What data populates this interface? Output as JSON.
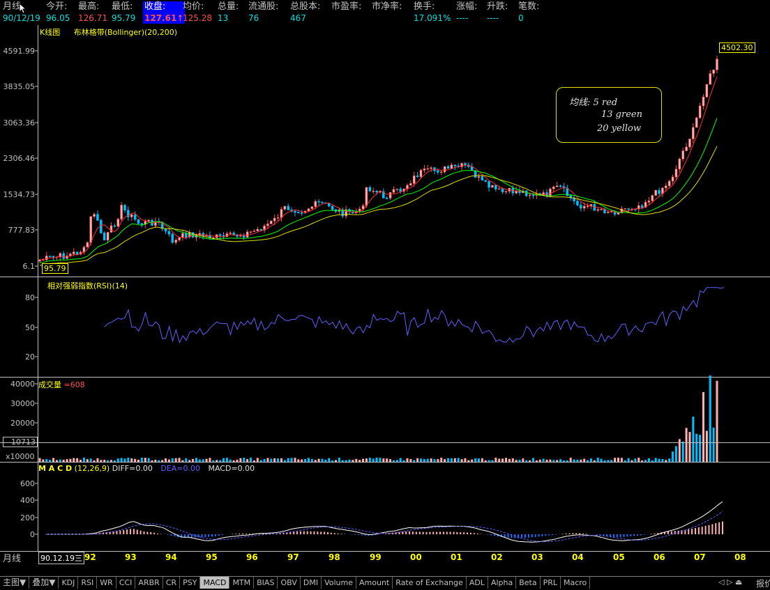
{
  "header": {
    "period_label": "月线",
    "date": "90/12/19",
    "fields": [
      {
        "label": "今开:",
        "value": "96.05",
        "color": "#00e0e0"
      },
      {
        "label": "最高:",
        "value": "126.71",
        "color": "#ff5050"
      },
      {
        "label": "最低:",
        "value": "95.79",
        "color": "#00e0e0"
      },
      {
        "label": "收盘:",
        "value": "127.61↑",
        "color": "#ff5050",
        "highlight": true
      },
      {
        "label": "均价:",
        "value": "125.28",
        "color": "#ff5050"
      },
      {
        "label": "总量:",
        "value": "13",
        "color": "#00e0e0"
      },
      {
        "label": "流通股:",
        "value": "76",
        "color": "#00e0e0"
      },
      {
        "label": "总股本:",
        "value": "467",
        "color": "#00e0e0"
      },
      {
        "label": "市盈率:",
        "value": "",
        "color": "#00e0e0"
      },
      {
        "label": "市净率:",
        "value": "",
        "color": "#00e0e0"
      },
      {
        "label": "换手:",
        "value": "17.091%",
        "color": "#00e0e0"
      },
      {
        "label": "涨幅:",
        "value": "----",
        "color": "#00e0e0"
      },
      {
        "label": "升跌:",
        "value": "----",
        "color": "#00e0e0"
      },
      {
        "label": "笔数:",
        "value": "0",
        "color": "#00e0e0"
      }
    ]
  },
  "kline_panel": {
    "title_k": "K线图",
    "title_indicator": "布林格带(Bollinger)(20,200)",
    "y_ticks": [
      "4591.99",
      "3835.05",
      "3063.36",
      "2306.46",
      "1534.73",
      "777.83",
      "6.1"
    ],
    "last_price_tag": "4502.30",
    "low_tag": "95.79",
    "note_lines": [
      "均线:  5 red",
      "13 green",
      "20  yellow"
    ]
  },
  "rsi_panel": {
    "title": "相对强弱指数(RSI)(14)",
    "y_ticks": [
      "80",
      "50",
      "20"
    ]
  },
  "volume_panel": {
    "title": "成交量",
    "value": "=608",
    "y_ticks": [
      "40000",
      "30000",
      "20000"
    ],
    "cursor_value": "10713",
    "unit": "x10000"
  },
  "macd_panel": {
    "title": "M A C D",
    "params": "(12,26,9)",
    "diff": "DIFF=0.00",
    "dea": "DEA=0.00",
    "macd": "MACD=0.00",
    "y_ticks": [
      "600",
      "400",
      "200",
      "0"
    ]
  },
  "x_axis": {
    "period_label": "月线",
    "cursor_date": "90.12.19三",
    "years": [
      "92",
      "93",
      "94",
      "95",
      "96",
      "97",
      "98",
      "99",
      "00",
      "01",
      "02",
      "03",
      "04",
      "05",
      "06",
      "07",
      "08"
    ]
  },
  "bottom_tabs": {
    "main": "主图▼",
    "overlay": "叠加▼",
    "tabs": [
      "KDJ",
      "RSI",
      "WR",
      "CCI",
      "ARBR",
      "CR",
      "PSY",
      "MACD",
      "MTM",
      "BIAS",
      "OBV",
      "DMI",
      "Volume",
      "Amount",
      "Rate of Exchange",
      "ADL",
      "Alpha",
      "Beta",
      "PRL",
      "Macro"
    ],
    "active": "MACD",
    "right_label": "报价"
  },
  "colors": {
    "up": "#ff5050",
    "down": "#00c0ff",
    "ma5": "#ff3030",
    "ma13": "#00ff00",
    "ma20": "#e0e000",
    "rsi_line": "#6060ff",
    "grid": "#c0c0c0",
    "label_yellow": "#ffff00"
  },
  "chart_data": {
    "type": "candlestick",
    "period": "monthly",
    "x_range": [
      "1990-12",
      "2008"
    ],
    "y_range": [
      6.1,
      4591.99
    ],
    "last_close": 4502.3,
    "first_low": 95.79
  }
}
